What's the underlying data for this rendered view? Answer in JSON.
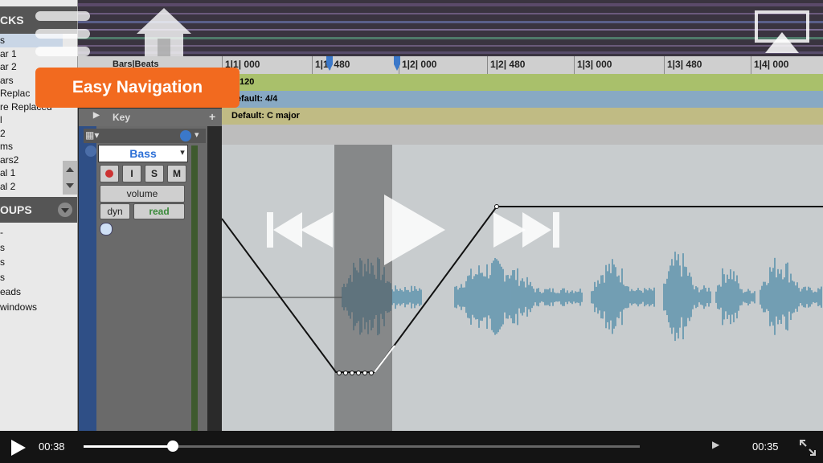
{
  "tracks": {
    "header": "CKS",
    "items": [
      "s",
      "ar 1",
      "ar 2",
      "ars",
      "Replac",
      "re Replaced",
      "l",
      "2",
      "ms",
      "ars2",
      "al 1",
      "al 2"
    ]
  },
  "groups": {
    "header": "OUPS",
    "items": [
      "-",
      "s",
      "s",
      "s",
      "eads",
      "windows"
    ]
  },
  "ruler": {
    "label": "Bars|Beats",
    "marks": [
      "1|1| 000",
      "1|1| 480",
      "1|2| 000",
      "1|2| 480",
      "1|3| 000",
      "1|3| 480",
      "1|4| 000"
    ]
  },
  "rulers": {
    "tempo": "120",
    "meter": "Default: 4/4",
    "key": "Default: C major",
    "key_label": "Key"
  },
  "strip": {
    "track_name": "Bass",
    "rec": "",
    "input": "I",
    "solo": "S",
    "mute": "M",
    "view": "volume",
    "dyn": "dyn",
    "auto_mode": "read"
  },
  "callout": {
    "text": "Easy Navigation"
  },
  "player": {
    "elapsed": "00:38",
    "remaining": "00:35",
    "progress": 0.16
  },
  "colors": {
    "callout": "#f26a1f",
    "tempo": "#a9c06b",
    "meter": "#88a9c3",
    "key": "#c0bb84",
    "waveform": "#4d8aa8",
    "track_name": "#2c6fd6",
    "auto_read": "#3a8a3a"
  },
  "icons": [
    "menu-icon",
    "home-icon",
    "airplay-icon",
    "rewind-icon",
    "play-icon",
    "fast-forward-icon",
    "fullscreen-icon"
  ]
}
